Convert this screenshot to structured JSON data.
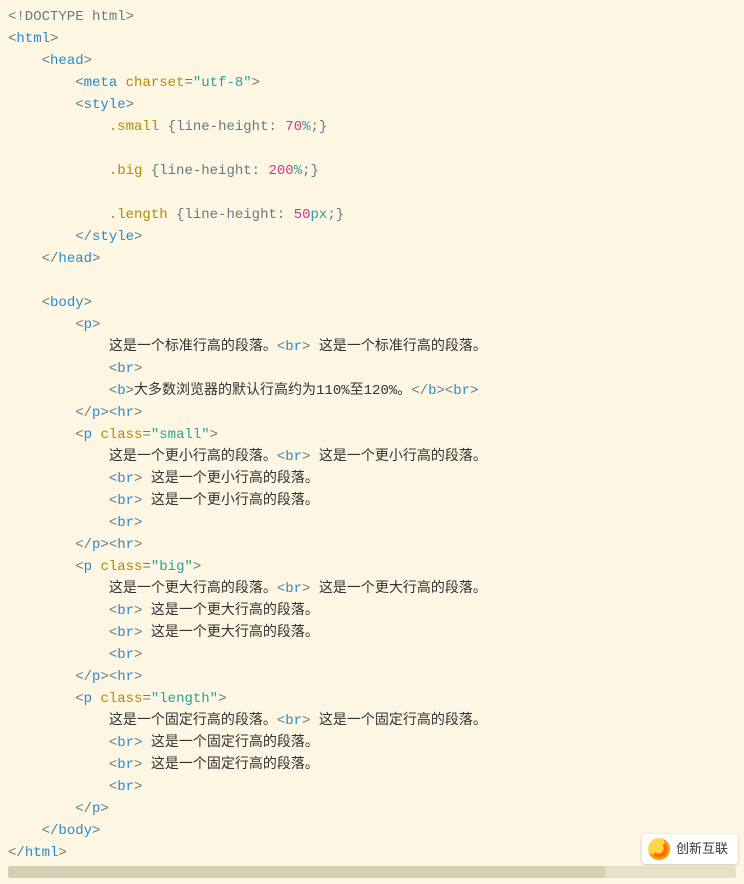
{
  "code": {
    "l01": {
      "a": "<!DOCTYPE html>"
    },
    "l02": {
      "a": "<",
      "b": "html",
      "c": ">"
    },
    "l03": {
      "a": "    <",
      "b": "head",
      "c": ">"
    },
    "l04": {
      "a": "        <",
      "b": "meta",
      "c": " ",
      "d": "charset",
      "e": "=",
      "f": "\"utf-8\"",
      "g": ">"
    },
    "l05": {
      "a": "        <",
      "b": "style",
      "c": ">"
    },
    "l06": {
      "a": "            ",
      "b": ".small",
      "c": " {",
      "d": "line-height",
      "e": ": ",
      "f": "70",
      "g": "%",
      "h": ";}"
    },
    "l07": {
      "a": ""
    },
    "l08": {
      "a": "            ",
      "b": ".big",
      "c": " {",
      "d": "line-height",
      "e": ": ",
      "f": "200",
      "g": "%",
      "h": ";}"
    },
    "l09": {
      "a": ""
    },
    "l10": {
      "a": "            ",
      "b": ".length",
      "c": " {",
      "d": "line-height",
      "e": ": ",
      "f": "50",
      "g": "px",
      "h": ";}"
    },
    "l11": {
      "a": "        </",
      "b": "style",
      "c": ">"
    },
    "l12": {
      "a": "    </",
      "b": "head",
      "c": ">"
    },
    "l13": {
      "a": ""
    },
    "l14": {
      "a": "    <",
      "b": "body",
      "c": ">"
    },
    "l15": {
      "a": "        <",
      "b": "p",
      "c": ">"
    },
    "l16": {
      "a": "            ",
      "b": "这是一个标准行高的段落。",
      "c": "<",
      "d": "br",
      "e": "> ",
      "f": "这是一个标准行高的段落。"
    },
    "l17": {
      "a": "            <",
      "b": "br",
      "c": ">"
    },
    "l18": {
      "a": "            <",
      "b": "b",
      "c": ">",
      "d": "大多数浏览器的默认行高约为110%至120%。",
      "e": "</",
      "f": "b",
      "g": "><",
      "h": "br",
      "i": ">"
    },
    "l19": {
      "a": "        </",
      "b": "p",
      "c": "><",
      "d": "hr",
      "e": ">"
    },
    "l20": {
      "a": "        <",
      "b": "p",
      "c": " ",
      "d": "class",
      "e": "=",
      "f": "\"small\"",
      "g": ">"
    },
    "l21": {
      "a": "            ",
      "b": "这是一个更小行高的段落。",
      "c": "<",
      "d": "br",
      "e": "> ",
      "f": "这是一个更小行高的段落。"
    },
    "l22": {
      "a": "            <",
      "b": "br",
      "c": "> ",
      "d": "这是一个更小行高的段落。"
    },
    "l23": {
      "a": "            <",
      "b": "br",
      "c": "> ",
      "d": "这是一个更小行高的段落。"
    },
    "l24": {
      "a": "            <",
      "b": "br",
      "c": ">"
    },
    "l25": {
      "a": "        </",
      "b": "p",
      "c": "><",
      "d": "hr",
      "e": ">"
    },
    "l26": {
      "a": "        <",
      "b": "p",
      "c": " ",
      "d": "class",
      "e": "=",
      "f": "\"big\"",
      "g": ">"
    },
    "l27": {
      "a": "            ",
      "b": "这是一个更大行高的段落。",
      "c": "<",
      "d": "br",
      "e": "> ",
      "f": "这是一个更大行高的段落。"
    },
    "l28": {
      "a": "            <",
      "b": "br",
      "c": "> ",
      "d": "这是一个更大行高的段落。"
    },
    "l29": {
      "a": "            <",
      "b": "br",
      "c": "> ",
      "d": "这是一个更大行高的段落。"
    },
    "l30": {
      "a": "            <",
      "b": "br",
      "c": ">"
    },
    "l31": {
      "a": "        </",
      "b": "p",
      "c": "><",
      "d": "hr",
      "e": ">"
    },
    "l32": {
      "a": "        <",
      "b": "p",
      "c": " ",
      "d": "class",
      "e": "=",
      "f": "\"length\"",
      "g": ">"
    },
    "l33": {
      "a": "            ",
      "b": "这是一个固定行高的段落。",
      "c": "<",
      "d": "br",
      "e": "> ",
      "f": "这是一个固定行高的段落。"
    },
    "l34": {
      "a": "            <",
      "b": "br",
      "c": "> ",
      "d": "这是一个固定行高的段落。"
    },
    "l35": {
      "a": "            <",
      "b": "br",
      "c": "> ",
      "d": "这是一个固定行高的段落。"
    },
    "l36": {
      "a": "            <",
      "b": "br",
      "c": ">"
    },
    "l37": {
      "a": "        </",
      "b": "p",
      "c": ">"
    },
    "l38": {
      "a": "    </",
      "b": "body",
      "c": ">"
    },
    "l39": {
      "a": "</",
      "b": "html",
      "c": ">"
    }
  },
  "logo_text": "创新互联"
}
